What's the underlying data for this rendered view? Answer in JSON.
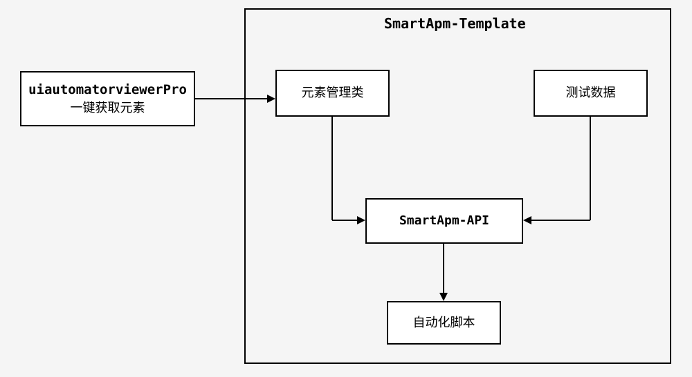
{
  "container": {
    "title": "SmartApm-Template"
  },
  "boxes": {
    "left": {
      "title": "uiautomatorviewerPro",
      "subtitle": "一键获取元素"
    },
    "elementMgr": "元素管理类",
    "testData": "测试数据",
    "api": "SmartApm-API",
    "script": "自动化脚本"
  }
}
